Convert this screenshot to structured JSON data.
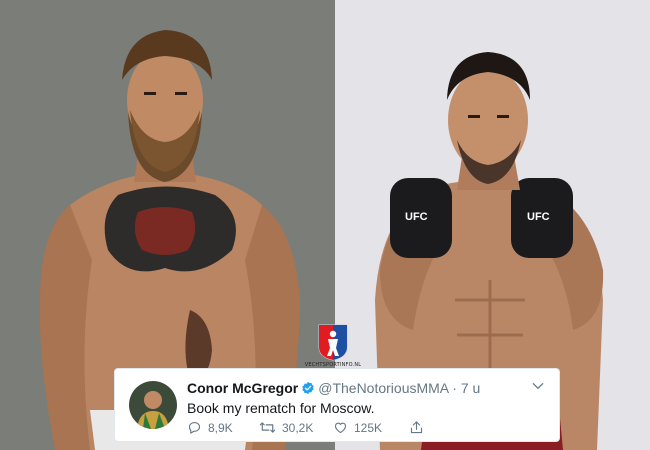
{
  "logo": {
    "caption": "VECHTSPORTINFO.NL"
  },
  "tweet": {
    "name": "Conor McGregor",
    "handle": "@TheNotoriousMMA",
    "separator": "·",
    "time": "7 u",
    "text": "Book my rematch for Moscow.",
    "replies": "8,9K",
    "retweets": "30,2K",
    "likes": "125K"
  },
  "icons": [
    "verified-badge-icon",
    "chevron-down-icon",
    "reply-icon",
    "retweet-icon",
    "like-icon",
    "share-icon"
  ],
  "colors": {
    "left_bg": "#7b7d79",
    "right_bg": "#e3e3e8",
    "verified": "#1da1f2",
    "muted": "#657786",
    "text": "#14171a"
  }
}
